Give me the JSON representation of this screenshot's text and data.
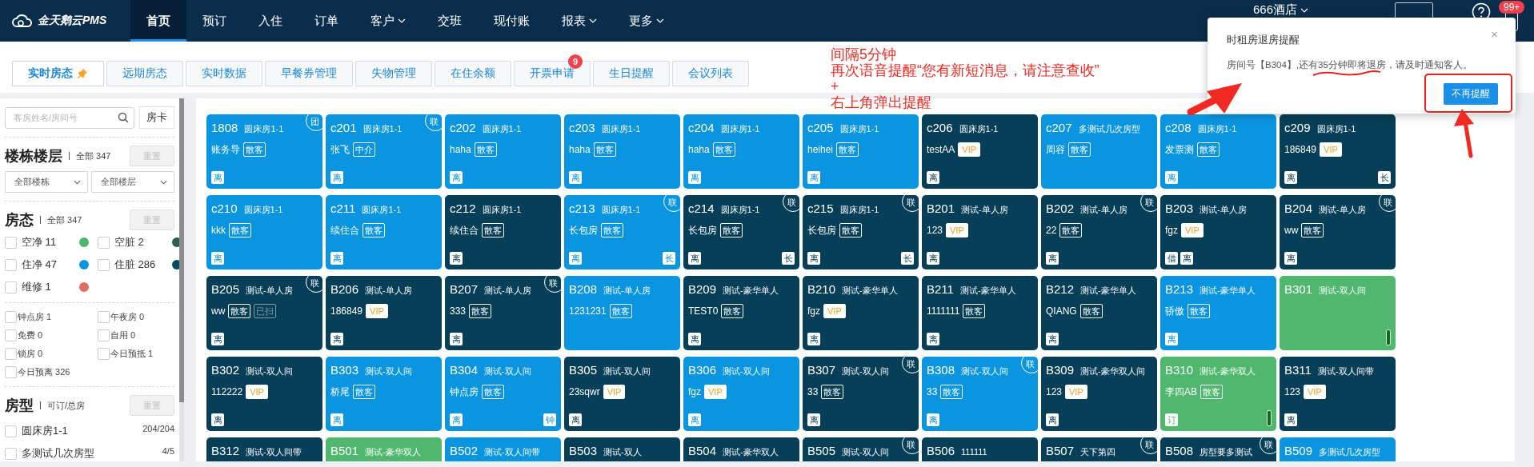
{
  "nav": {
    "logo": "金天鹅云PMS",
    "items": [
      {
        "label": "首页",
        "selected": true,
        "dropdown": false
      },
      {
        "label": "预订",
        "selected": false,
        "dropdown": false
      },
      {
        "label": "入住",
        "selected": false,
        "dropdown": false
      },
      {
        "label": "订单",
        "selected": false,
        "dropdown": false
      },
      {
        "label": "客户",
        "selected": false,
        "dropdown": true
      },
      {
        "label": "交班",
        "selected": false,
        "dropdown": false
      },
      {
        "label": "现付账",
        "selected": false,
        "dropdown": false
      },
      {
        "label": "报表",
        "selected": false,
        "dropdown": true
      },
      {
        "label": "更多",
        "selected": false,
        "dropdown": true
      }
    ],
    "hotel": "666酒店",
    "notification_badge": "99+"
  },
  "tabs": [
    {
      "label": "实时房态",
      "selected": true,
      "pinned": true
    },
    {
      "label": "远期房态",
      "selected": false,
      "pinned": false
    },
    {
      "label": "实时数据",
      "selected": false,
      "pinned": false
    },
    {
      "label": "早餐券管理",
      "selected": false,
      "pinned": false
    },
    {
      "label": "失物管理",
      "selected": false,
      "pinned": false
    },
    {
      "label": "在住余额",
      "selected": false,
      "pinned": false
    },
    {
      "label": "开票申请",
      "selected": false,
      "pinned": false,
      "badge": "9"
    },
    {
      "label": "生日提醒",
      "selected": false,
      "pinned": false
    },
    {
      "label": "会议列表",
      "selected": false,
      "pinned": false
    }
  ],
  "sidebar": {
    "search": {
      "placeholder": "客房姓名/房间号"
    },
    "card_button": "房卡",
    "building": {
      "title": "楼栋楼层",
      "summary": "全部 347",
      "reset": "重置",
      "reset_disabled": true,
      "selects": [
        "全部楼栋",
        "全部楼层"
      ]
    },
    "status": {
      "title": "房态",
      "summary": "全部 347",
      "reset": "重置",
      "reset_disabled": true,
      "items": [
        {
          "label": "空净 11",
          "color": "#4cb86b",
          "checked": false
        },
        {
          "label": "空脏 2",
          "color": "#2a5e46",
          "checked": false
        },
        {
          "label": "住净 47",
          "color": "#0a95e0",
          "checked": false
        },
        {
          "label": "住脏 286",
          "color": "#064a5e",
          "checked": false
        },
        {
          "label": "维修 1",
          "color": "#e06c62",
          "checked": false
        }
      ]
    },
    "filters": [
      {
        "label": "钟点房 1",
        "checked": false
      },
      {
        "label": "午夜房 0",
        "checked": false
      },
      {
        "label": "免费 0",
        "checked": false
      },
      {
        "label": "自用 0",
        "checked": false
      },
      {
        "label": "锁房 0",
        "checked": false
      },
      {
        "label": "今日预抵 1",
        "checked": false
      },
      {
        "label": "今日预离 326",
        "checked": false
      }
    ],
    "room_types": {
      "title": "房型",
      "summary": "可订/总房",
      "reset": "重置",
      "reset_disabled": true,
      "items": [
        {
          "name": "圆床房1-1",
          "count": "204/204",
          "checked": false
        },
        {
          "name": "多测试几次房型",
          "count": "4/5",
          "checked": false
        }
      ]
    }
  },
  "rooms": [
    {
      "number": "1808",
      "type": "圆床房1-1",
      "color": "#0a95e0",
      "guest": "账务导",
      "tags": [
        {
          "text": "散客",
          "kind": "source"
        }
      ],
      "left_badges": [
        "离"
      ],
      "corner": "团",
      "indicator": false
    },
    {
      "number": "c201",
      "type": "圆床房1-1",
      "color": "#0a95e0",
      "guest": "张飞",
      "tags": [
        {
          "text": "中介",
          "kind": "source"
        }
      ],
      "left_badges": [
        "离"
      ],
      "corner": "联",
      "indicator": false
    },
    {
      "number": "c202",
      "type": "圆床房1-1",
      "color": "#0a95e0",
      "guest": "haha",
      "tags": [
        {
          "text": "散客",
          "kind": "source"
        }
      ],
      "left_badges": [
        "离"
      ],
      "indicator": false
    },
    {
      "number": "c203",
      "type": "圆床房1-1",
      "color": "#0a95e0",
      "guest": "haha",
      "tags": [
        {
          "text": "散客",
          "kind": "source"
        }
      ],
      "left_badges": [
        "离"
      ],
      "indicator": false
    },
    {
      "number": "c204",
      "type": "圆床房1-1",
      "color": "#0a95e0",
      "guest": "haha",
      "tags": [
        {
          "text": "散客",
          "kind": "source"
        }
      ],
      "left_badges": [
        "离"
      ],
      "indicator": false
    },
    {
      "number": "c205",
      "type": "圆床房1-1",
      "color": "#0a95e0",
      "guest": "heihei",
      "tags": [
        {
          "text": "散客",
          "kind": "source"
        }
      ],
      "left_badges": [
        "离"
      ],
      "indicator": false
    },
    {
      "number": "c206",
      "type": "圆床房1-1",
      "color": "#063f57",
      "guest": "testAA",
      "tags": [
        {
          "text": "VIP",
          "kind": "vip"
        }
      ],
      "left_badges": [
        "离"
      ],
      "indicator": false
    },
    {
      "number": "c207",
      "type": "多测试几次房型",
      "color": "#0a95e0",
      "guest": "周容",
      "tags": [
        {
          "text": "散客",
          "kind": "source"
        }
      ],
      "indicator": false
    },
    {
      "number": "c208",
      "type": "圆床房1-1",
      "color": "#0a95e0",
      "guest": "发票测",
      "tags": [
        {
          "text": "散客",
          "kind": "source"
        }
      ],
      "left_badges": [
        "离"
      ],
      "indicator": false
    },
    {
      "number": "c209",
      "type": "圆床房1-1",
      "color": "#063f57",
      "guest": "186849",
      "tags": [
        {
          "text": "VIP",
          "kind": "vip"
        }
      ],
      "left_badges": [
        "离"
      ],
      "right_badge": "长",
      "indicator": false
    },
    {
      "number": "c210",
      "type": "圆床房1-1",
      "color": "#0a95e0",
      "guest": "kkk",
      "tags": [
        {
          "text": "散客",
          "kind": "source"
        }
      ],
      "left_badges": [
        "离"
      ],
      "indicator": false
    },
    {
      "number": "c211",
      "type": "圆床房1-1",
      "color": "#0a95e0",
      "guest": "续住合",
      "tags": [
        {
          "text": "散客",
          "kind": "source"
        }
      ],
      "left_badges": [
        "离"
      ],
      "indicator": false
    },
    {
      "number": "c212",
      "type": "圆床房1-1",
      "color": "#063f57",
      "guest": "续住合",
      "tags": [
        {
          "text": "散客",
          "kind": "source"
        }
      ],
      "left_badges": [
        "离"
      ],
      "indicator": false
    },
    {
      "number": "c213",
      "type": "圆床房1-1",
      "color": "#0a95e0",
      "guest": "长包房",
      "tags": [
        {
          "text": "散客",
          "kind": "source"
        }
      ],
      "left_badges": [
        "离"
      ],
      "right_badge": "长",
      "corner": "联",
      "indicator": false
    },
    {
      "number": "c214",
      "type": "圆床房1-1",
      "color": "#063f57",
      "guest": "长包房",
      "tags": [
        {
          "text": "散客",
          "kind": "source"
        }
      ],
      "left_badges": [
        "离"
      ],
      "right_badge": "长",
      "corner": "联",
      "indicator": false
    },
    {
      "number": "c215",
      "type": "圆床房1-1",
      "color": "#063f57",
      "guest": "长包房",
      "tags": [
        {
          "text": "散客",
          "kind": "source"
        }
      ],
      "left_badges": [
        "离"
      ],
      "right_badge": "长",
      "corner": "联",
      "indicator": false
    },
    {
      "number": "B201",
      "type": "测试-单人房",
      "color": "#063f57",
      "guest": "123",
      "tags": [
        {
          "text": "VIP",
          "kind": "vip"
        }
      ],
      "left_badges": [
        "离"
      ],
      "indicator": false
    },
    {
      "number": "B202",
      "type": "测试-单人房",
      "color": "#063f57",
      "guest": "22",
      "tags": [
        {
          "text": "散客",
          "kind": "source"
        }
      ],
      "left_badges": [
        "离"
      ],
      "corner": "联",
      "indicator": false
    },
    {
      "number": "B203",
      "type": "测试-单人房",
      "color": "#063f57",
      "guest": "fgz",
      "tags": [
        {
          "text": "VIP",
          "kind": "vip"
        }
      ],
      "left_badges": [
        "借",
        "离"
      ],
      "indicator": false
    },
    {
      "number": "B204",
      "type": "测试-单人房",
      "color": "#063f57",
      "guest": "ww",
      "tags": [
        {
          "text": "散客",
          "kind": "source"
        }
      ],
      "left_badges": [
        "离"
      ],
      "corner": "联",
      "indicator": false
    },
    {
      "number": "B205",
      "type": "测试-单人房",
      "color": "#063f57",
      "guest": "ww",
      "tags": [
        {
          "text": "散客",
          "kind": "source"
        },
        {
          "text": "已扫",
          "kind": "scanned"
        }
      ],
      "left_badges": [
        "离"
      ],
      "corner": "联",
      "indicator": false
    },
    {
      "number": "B206",
      "type": "测试-单人房",
      "color": "#063f57",
      "guest": "186849",
      "tags": [
        {
          "text": "VIP",
          "kind": "vip"
        }
      ],
      "left_badges": [
        "离"
      ],
      "indicator": false
    },
    {
      "number": "B207",
      "type": "测试-单人房",
      "color": "#063f57",
      "guest": "333",
      "tags": [
        {
          "text": "散客",
          "kind": "source"
        }
      ],
      "left_badges": [
        "离"
      ],
      "corner": "联",
      "indicator": false
    },
    {
      "number": "B208",
      "type": "测试-单人房",
      "color": "#0a95e0",
      "guest": "1231231",
      "tags": [
        {
          "text": "散客",
          "kind": "source"
        }
      ],
      "indicator": false
    },
    {
      "number": "B209",
      "type": "测试-豪华单人",
      "color": "#063f57",
      "guest": "TEST0",
      "tags": [
        {
          "text": "散客",
          "kind": "source"
        }
      ],
      "left_badges": [
        "离"
      ],
      "indicator": false
    },
    {
      "number": "B210",
      "type": "测试-豪华单人",
      "color": "#063f57",
      "guest": "fgz",
      "tags": [
        {
          "text": "VIP",
          "kind": "vip"
        }
      ],
      "left_badges": [
        "离"
      ],
      "indicator": false
    },
    {
      "number": "B211",
      "type": "测试-豪华单人",
      "color": "#063f57",
      "guest": "1111111",
      "tags": [
        {
          "text": "散客",
          "kind": "source"
        }
      ],
      "left_badges": [
        "离"
      ],
      "indicator": false
    },
    {
      "number": "B212",
      "type": "测试-豪华单人",
      "color": "#063f57",
      "guest": "QIANG",
      "tags": [
        {
          "text": "散客",
          "kind": "source"
        }
      ],
      "left_badges": [
        "离"
      ],
      "indicator": false
    },
    {
      "number": "B213",
      "type": "测试-豪华单人",
      "color": "#0a95e0",
      "guest": "骄傲",
      "tags": [
        {
          "text": "散客",
          "kind": "source"
        }
      ],
      "left_badges": [
        "离"
      ],
      "indicator": false
    },
    {
      "number": "B301",
      "type": "测试-双人间",
      "color": "#4fb86e",
      "indicator": true
    },
    {
      "number": "B302",
      "type": "测试-双人间",
      "color": "#063f57",
      "guest": "112222",
      "tags": [
        {
          "text": "VIP",
          "kind": "vip"
        }
      ],
      "left_badges": [
        "离"
      ],
      "indicator": false
    },
    {
      "number": "B303",
      "type": "测试-双人间",
      "color": "#0a95e0",
      "guest": "桥尾",
      "tags": [
        {
          "text": "散客",
          "kind": "source"
        }
      ],
      "left_badges": [
        "离"
      ],
      "indicator": false
    },
    {
      "number": "B304",
      "type": "测试-双人间",
      "color": "#0a95e0",
      "guest": "钟点房",
      "tags": [
        {
          "text": "散客",
          "kind": "source"
        }
      ],
      "left_badges": [
        "离"
      ],
      "right_badge": "钟",
      "indicator": false
    },
    {
      "number": "B305",
      "type": "测试-双人间",
      "color": "#063f57",
      "guest": "23sqwr",
      "tags": [
        {
          "text": "VIP",
          "kind": "vip"
        }
      ],
      "left_badges": [
        "离"
      ],
      "indicator": false
    },
    {
      "number": "B306",
      "type": "测试-双人间",
      "color": "#0a95e0",
      "guest": "fgz",
      "tags": [
        {
          "text": "VIP",
          "kind": "vip"
        }
      ],
      "left_badges": [
        "离"
      ],
      "indicator": false
    },
    {
      "number": "B307",
      "type": "测试-双人间",
      "color": "#063f57",
      "guest": "33",
      "tags": [
        {
          "text": "散客",
          "kind": "source"
        }
      ],
      "left_badges": [
        "离"
      ],
      "corner": "联",
      "indicator": false
    },
    {
      "number": "B308",
      "type": "测试-双人间",
      "color": "#0a95e0",
      "guest": "33",
      "tags": [
        {
          "text": "散客",
          "kind": "source"
        }
      ],
      "left_badges": [
        "离"
      ],
      "corner": "联",
      "indicator": false
    },
    {
      "number": "B309",
      "type": "测试-豪华双人间",
      "color": "#063f57",
      "guest": "123",
      "tags": [
        {
          "text": "VIP",
          "kind": "vip"
        }
      ],
      "left_badges": [
        "离"
      ],
      "indicator": false
    },
    {
      "number": "B310",
      "type": "测试-豪华双人",
      "color": "#4fb86e",
      "guest": "李四AB",
      "tags": [
        {
          "text": "散客",
          "kind": "source"
        }
      ],
      "left_badges": [
        "订"
      ],
      "indicator": true
    },
    {
      "number": "B311",
      "type": "测试-双人间带",
      "color": "#063f57",
      "guest": "123",
      "tags": [
        {
          "text": "VIP",
          "kind": "vip"
        }
      ],
      "left_badges": [
        "离"
      ],
      "indicator": false
    },
    {
      "number": "B312",
      "type": "测试-双人间带",
      "color": "#063f57",
      "indicator": false
    },
    {
      "number": "B501",
      "type": "测试-豪华双人",
      "color": "#4fb86e",
      "indicator": false
    },
    {
      "number": "B502",
      "type": "测试-双人间带",
      "color": "#0a95e0",
      "indicator": false
    },
    {
      "number": "B503",
      "type": "测试-双人",
      "color": "#063f57",
      "indicator": false
    },
    {
      "number": "B504",
      "type": "测试-豪华双人",
      "color": "#063f57",
      "indicator": false
    },
    {
      "number": "B505",
      "type": "测试-双人间",
      "color": "#063f57",
      "corner": "联",
      "indicator": false
    },
    {
      "number": "B506",
      "type": "111111",
      "color": "#063f57",
      "indicator": false
    },
    {
      "number": "B507",
      "type": "天下第四",
      "color": "#063f57",
      "corner": "联",
      "indicator": false
    },
    {
      "number": "B508",
      "type": "房型要多测试",
      "color": "#063f57",
      "corner": "联",
      "indicator": false
    },
    {
      "number": "B509",
      "type": "多测试几次房型",
      "color": "#0a95e0",
      "indicator": false
    }
  ],
  "popup": {
    "title": "时租房退房提醒",
    "close": "×",
    "message": "房间号【B304】,还有35分钟即将退房，请及时通知客人。",
    "button": "不再提醒"
  },
  "annotation": {
    "lines": [
      "间隔5分钟",
      "再次语音提醒“您有新短消息，请注意查收”",
      "+",
      "右上角弹出提醒"
    ]
  }
}
